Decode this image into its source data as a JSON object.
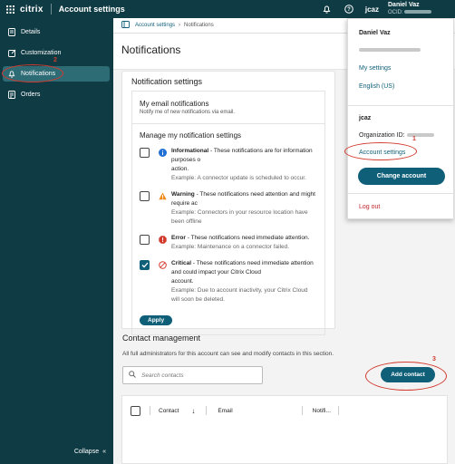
{
  "topbar": {
    "logo": "citrix",
    "title": "Account settings",
    "customer": "jcaz",
    "user_name": "Daniel Vaz",
    "org_prefix": "OCID:"
  },
  "sidebar": {
    "items": [
      {
        "label": "Details",
        "icon": "details-icon"
      },
      {
        "label": "Customization",
        "icon": "edit-icon"
      },
      {
        "label": "Notifications",
        "icon": "bell-icon",
        "active": true
      },
      {
        "label": "Orders",
        "icon": "orders-icon"
      }
    ],
    "collapse_label": "Collapse"
  },
  "breadcrumb": {
    "items": [
      "Account settings",
      "Notifications"
    ]
  },
  "page_title": "Notifications",
  "notification_settings": {
    "title": "Notification settings",
    "email_title": "My email notifications",
    "email_desc": "Notify me of new notifications via email.",
    "manage_title": "Manage my notification settings",
    "items": [
      {
        "name": "Informational",
        "desc": " - These notifications are for information purposes o",
        "desc2": "action.",
        "example_label": "Example:",
        "example": " A connector update is scheduled to occur.",
        "checked": false,
        "color": "#1f6fd6"
      },
      {
        "name": "Warning",
        "desc": " - These notifications need attention and might require ac",
        "desc2": "",
        "example_label": "Example:",
        "example": " Connectors in your resource location have been offline",
        "checked": false,
        "color": "#f08c1a"
      },
      {
        "name": "Error",
        "desc": " - These notifications need immediate attention.",
        "desc2": "",
        "example_label": "Example:",
        "example": " Maintenance on a connector failed.",
        "checked": false,
        "color": "#d23b2e"
      },
      {
        "name": "Critical",
        "desc": " - These notifications need immediate attention and could impact your Citrix Cloud",
        "desc2": "account.",
        "example_label": "Example:",
        "example": " Due to account inactivity, your Citrix Cloud will soon be deleted.",
        "checked": true,
        "color": "#d23b2e"
      }
    ],
    "apply_label": "Apply"
  },
  "contact_management": {
    "title": "Contact management",
    "desc": "All full administrators for this account can see and modify contacts in this section.",
    "search_placeholder": "Search contacts",
    "add_label": "Add contact",
    "columns": [
      "Contact",
      "Email",
      "Notifi..."
    ]
  },
  "dropdown": {
    "name": "Daniel Vaz",
    "my_settings": "My settings",
    "language": "English (US)",
    "customer": "jcaz",
    "org_label": "Organization ID:",
    "account_settings": "Account settings",
    "change_account": "Change account",
    "logout": "Log out"
  },
  "annotations": [
    "1",
    "2",
    "3"
  ],
  "colors": {
    "nav_bg": "#0f3b44",
    "accent": "#0f5f79",
    "annotation": "#d23b2e"
  }
}
